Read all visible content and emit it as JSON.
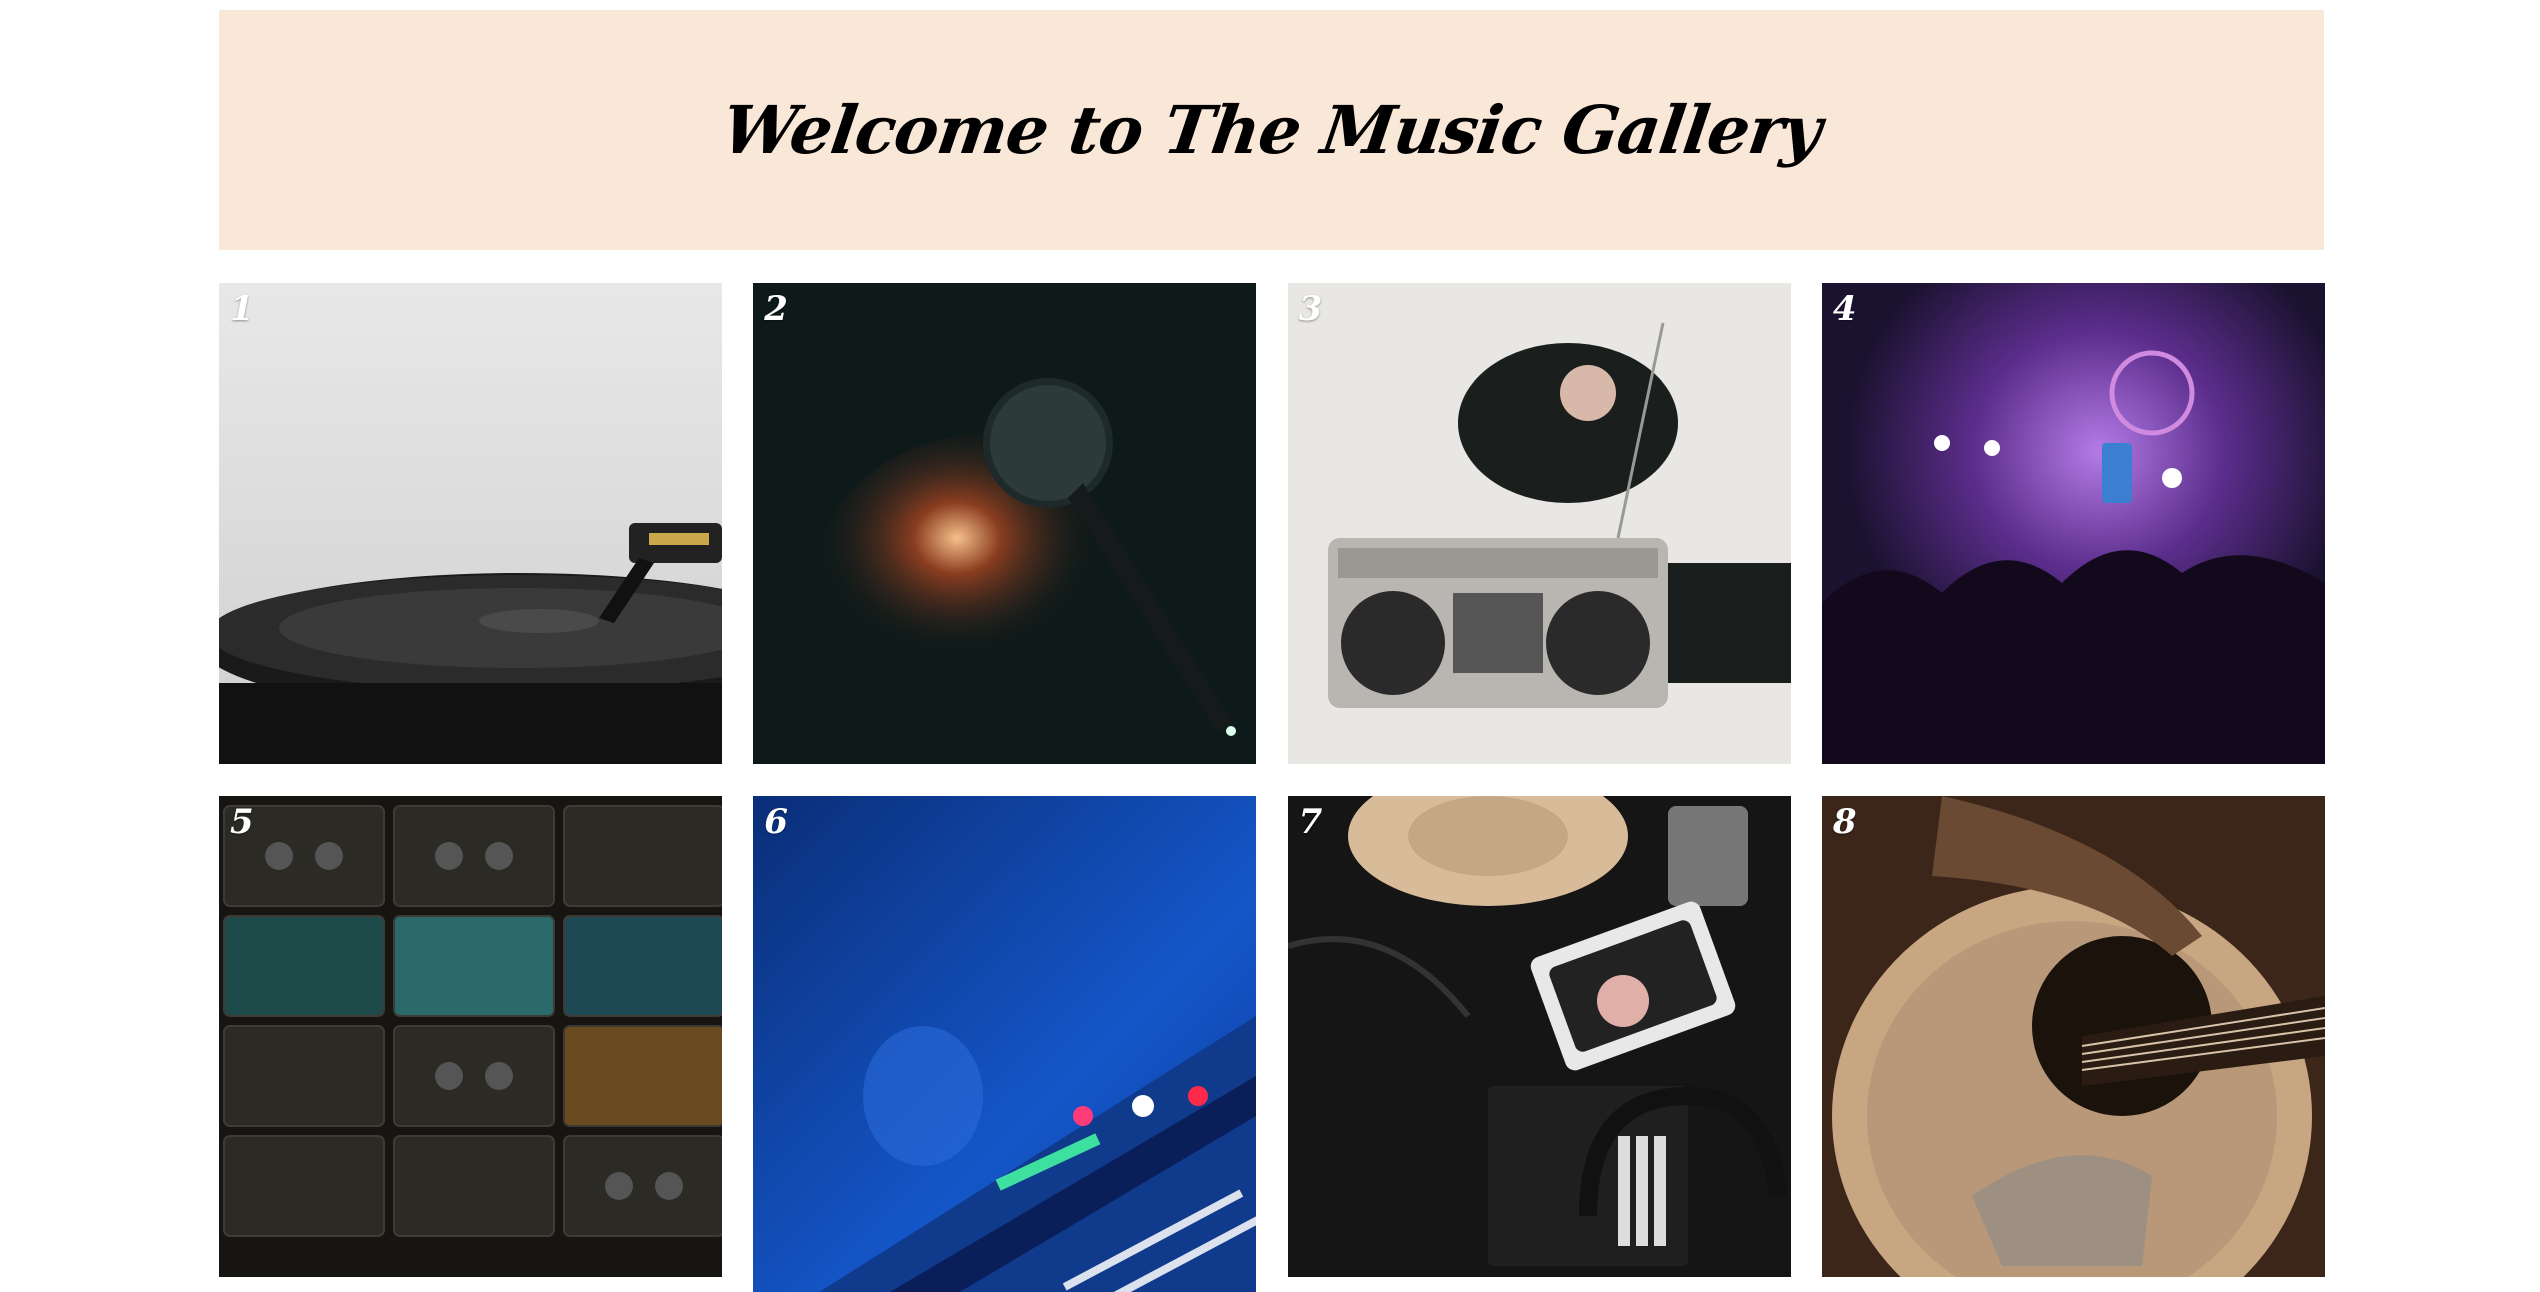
{
  "header": {
    "title": "Welcome to The Music Gallery"
  },
  "gallery": {
    "tiles": [
      {
        "number": "1",
        "subject": "turntable-record-image",
        "background": "#dcdcdc"
      },
      {
        "number": "2",
        "subject": "microphone-image",
        "background": "#0f1a1a"
      },
      {
        "number": "3",
        "subject": "boombox-image",
        "background": "#e6e5e2"
      },
      {
        "number": "4",
        "subject": "concert-crowd-image",
        "background": "#2a1740"
      },
      {
        "number": "5",
        "subject": "cassette-tapes-image",
        "background": "#1b1a16"
      },
      {
        "number": "6",
        "subject": "blue-keyboard-image",
        "background": "#0f3f9c"
      },
      {
        "number": "7",
        "subject": "audio-equipment-image",
        "background": "#151515"
      },
      {
        "number": "8",
        "subject": "acoustic-guitar-image",
        "background": "#3a2418"
      }
    ]
  }
}
